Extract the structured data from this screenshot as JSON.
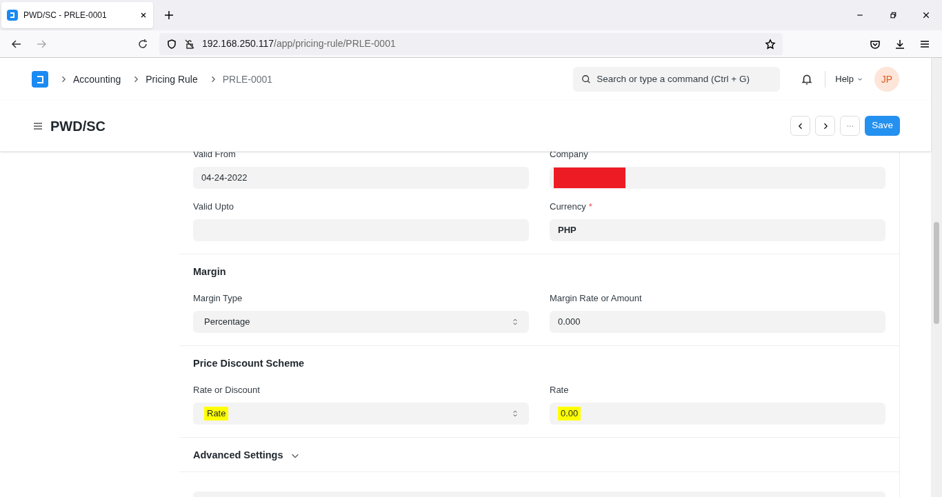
{
  "browser": {
    "tab_title": "PWD/SC - PRLE-0001",
    "url_host": "192.168.250.117",
    "url_path": "/app/pricing-rule/PRLE-0001"
  },
  "navbar": {
    "breadcrumbs": [
      {
        "label": "Accounting",
        "current": false
      },
      {
        "label": "Pricing Rule",
        "current": false
      },
      {
        "label": "PRLE-0001",
        "current": true
      }
    ],
    "search_placeholder": "Search or type a command (Ctrl + G)",
    "help": "Help",
    "avatar": "JP"
  },
  "page": {
    "title": "PWD/SC",
    "save": "Save"
  },
  "sections": [
    {
      "fields": [
        {
          "label": "Valid From",
          "value": "04-24-2022",
          "kind": "text"
        },
        {
          "label": "Company",
          "kind": "redacted"
        },
        {
          "label": "Valid Upto",
          "kind": "text"
        },
        {
          "label": "Currency",
          "required_mark": "*",
          "value": "PHP",
          "kind": "text",
          "bold": true
        }
      ]
    },
    {
      "title": "Margin",
      "fields": [
        {
          "label": "Margin Type",
          "value": "Percentage",
          "kind": "select"
        },
        {
          "label": "Margin Rate or Amount",
          "value": "0.000",
          "kind": "text"
        }
      ]
    },
    {
      "title": "Price Discount Scheme",
      "fields": [
        {
          "label": "Rate or Discount",
          "value": "Rate",
          "kind": "select",
          "highlighted": true
        },
        {
          "label": "Rate",
          "value": "0.00",
          "kind": "text",
          "highlighted": true
        }
      ]
    },
    {
      "title": "Advanced Settings",
      "collapsible": true
    }
  ]
}
